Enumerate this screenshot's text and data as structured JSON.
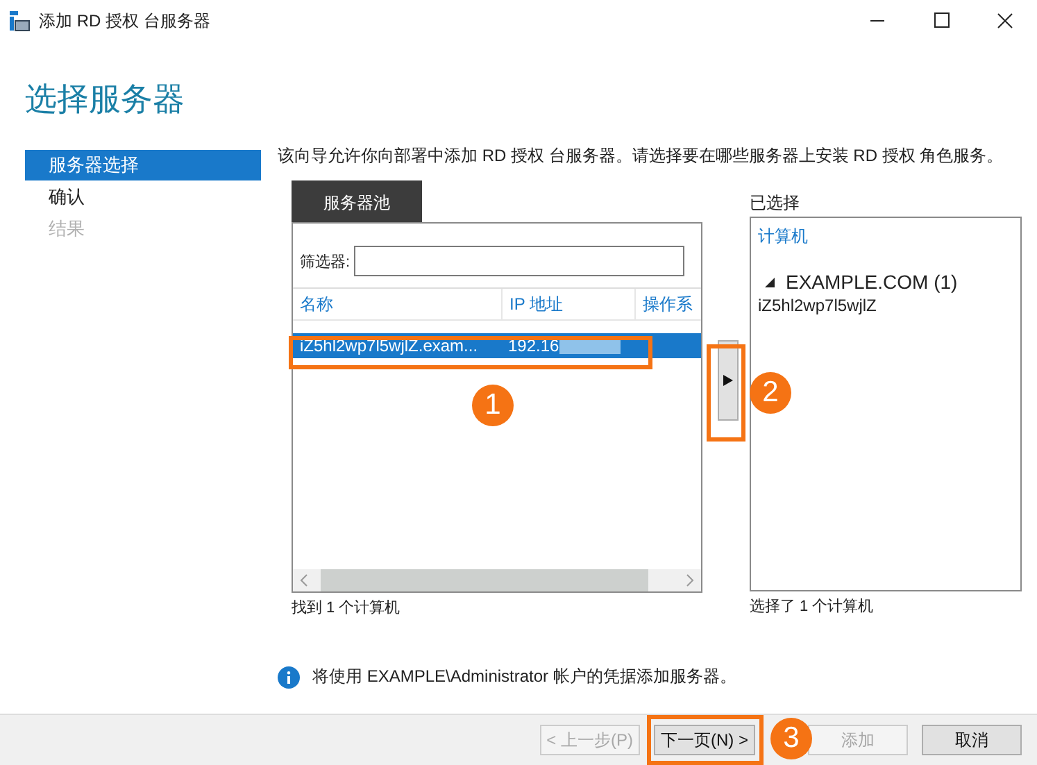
{
  "window": {
    "title": "添加 RD 授权 台服务器"
  },
  "page_title": "选择服务器",
  "steps": [
    {
      "label": "服务器选择",
      "selected": true,
      "disabled": false
    },
    {
      "label": "确认",
      "selected": false,
      "disabled": false
    },
    {
      "label": "结果",
      "selected": false,
      "disabled": true
    }
  ],
  "description": "该向导允许你向部署中添加 RD 授权 台服务器。请选择要在哪些服务器上安装 RD 授权 角色服务。",
  "pool": {
    "tab_label": "服务器池",
    "filter_label": "筛选器:",
    "columns": [
      "名称",
      "IP 地址",
      "操作系"
    ],
    "rows": [
      {
        "name": "iZ5hl2wp7l5wjlZ.exam...",
        "ip": "192.16",
        "selected": true
      }
    ],
    "found_text": "找到 1 个计算机"
  },
  "selected_panel": {
    "label": "已选择",
    "column": "计算机",
    "group": {
      "label": "EXAMPLE.COM (1)",
      "expanded": true
    },
    "items": [
      "iZ5hl2wp7l5wjlZ"
    ],
    "count_text": "选择了 1 个计算机"
  },
  "info_text": "将使用 EXAMPLE\\Administrator 帐户的凭据添加服务器。",
  "buttons": [
    {
      "label": "< 上一步(P)",
      "disabled": true
    },
    {
      "label": "下一页(N) >",
      "disabled": false
    },
    {
      "label": "添加",
      "disabled": true
    },
    {
      "label": "取消",
      "disabled": false
    }
  ],
  "callouts": [
    "1",
    "2",
    "3"
  ]
}
